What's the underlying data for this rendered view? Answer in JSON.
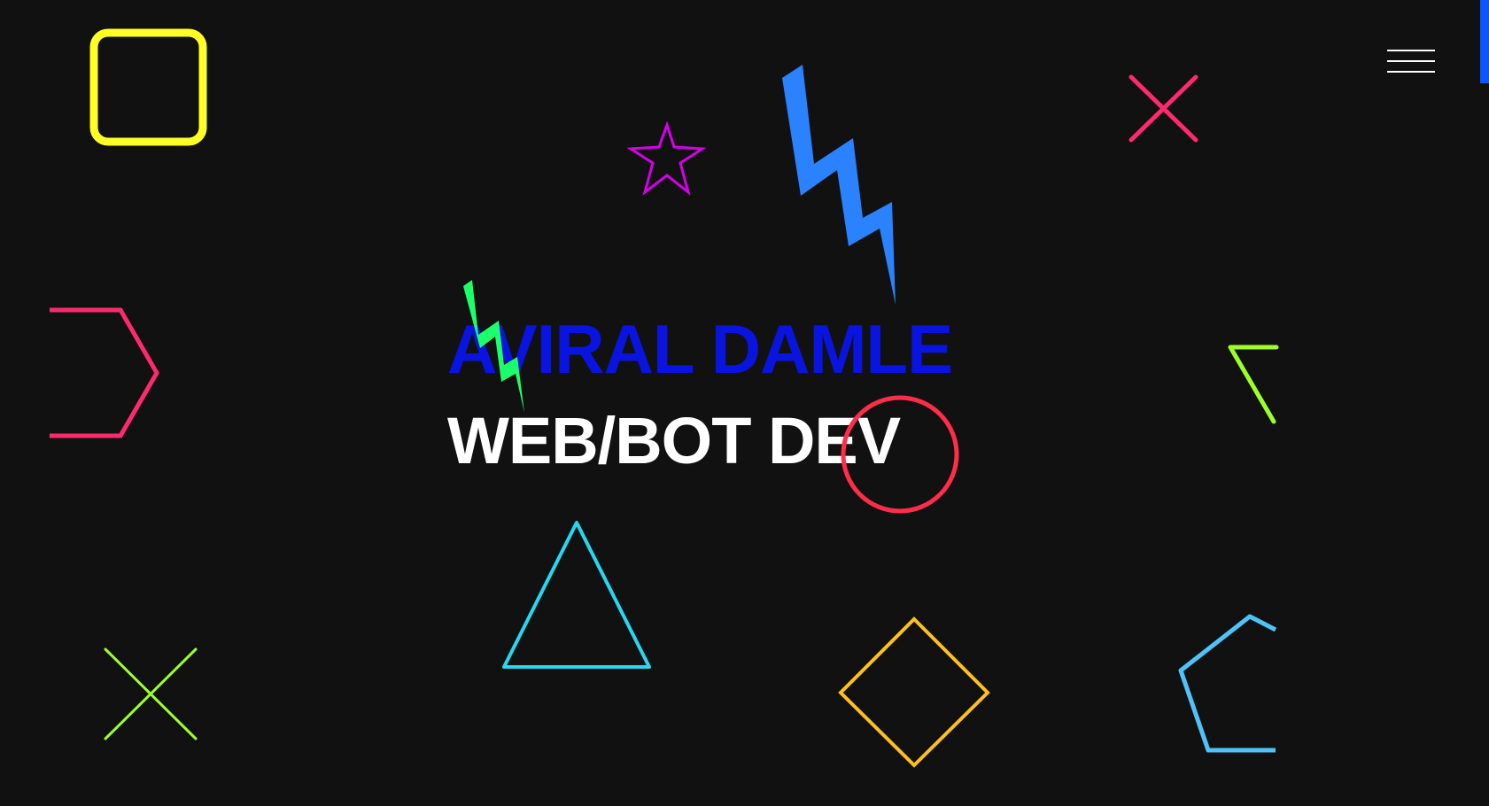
{
  "hero": {
    "name": "AVIRAL DAMLE",
    "role": "WEB/BOT DEV"
  },
  "nav": {
    "menu_icon": "hamburger-menu-icon"
  },
  "colors": {
    "background": "#111111",
    "name": "#0a14e0",
    "role": "#ffffff",
    "yellow": "#ffff26",
    "magenta": "#d400e8",
    "blue": "#2a82ff",
    "pink": "#ff2a6d",
    "lime": "#9dff26",
    "green": "#1bff6b",
    "cyan": "#23d8f0",
    "red": "#ff2d4a",
    "orange": "#ffbf1f",
    "sky": "#4fc3f7",
    "edge_accent": "#0a56ff"
  },
  "decorations": [
    "rounded-square-icon",
    "star-icon",
    "lightning-bolt-icon",
    "cross-icon",
    "hexagon-icon",
    "lightning-bolt-small-icon",
    "triangle-icon",
    "circle-icon",
    "diamond-icon",
    "pentagon-icon",
    "partial-triangle-icon",
    "cross-small-icon"
  ]
}
